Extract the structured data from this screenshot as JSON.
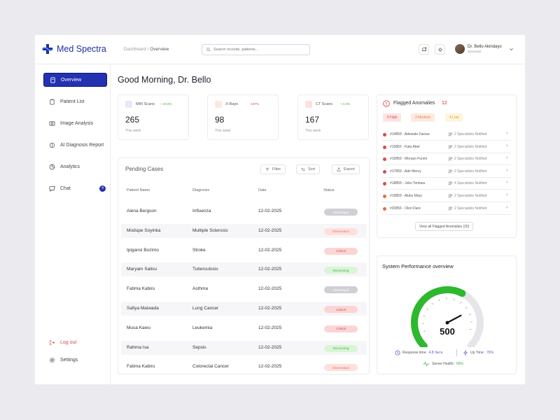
{
  "app": {
    "name": "Med Spectra"
  },
  "breadcrumb": {
    "parent": "Dashboard",
    "separator": " / ",
    "current": "Overview"
  },
  "search": {
    "placeholder": "Search records, patients..."
  },
  "user": {
    "name": "Dr. Bello Akindayo",
    "role": "Specialist"
  },
  "sidebar": {
    "items": [
      {
        "label": "Overview",
        "icon": "overview-icon",
        "active": true
      },
      {
        "label": "Patient List",
        "icon": "clipboard-icon"
      },
      {
        "label": "Image Analysis",
        "icon": "image-icon"
      },
      {
        "label": "AI Diagnosis Report",
        "icon": "brain-icon"
      },
      {
        "label": "Analytics",
        "icon": "pie-chart-icon"
      },
      {
        "label": "Chat",
        "icon": "chat-icon",
        "badge": "4"
      }
    ],
    "logout": "Log out",
    "settings": "Settings"
  },
  "greeting": "Good Morning, Dr. Bello",
  "stats": [
    {
      "name": "MRI Scans",
      "delta": "+ 20.8%",
      "value": "265",
      "sub": "This week",
      "trend": "up",
      "color": "#6b6bd0"
    },
    {
      "name": "X-Rays",
      "delta": "-107%",
      "value": "98",
      "sub": "This week",
      "trend": "down",
      "color": "#e07a5f"
    },
    {
      "name": "CT Scans",
      "delta": "+ 0.2%",
      "value": "167",
      "sub": "This week",
      "trend": "up",
      "color": "#d04040"
    }
  ],
  "cases": {
    "title": "Pending Cases",
    "filter": "Filter",
    "sort": "Sort",
    "export": "Export",
    "columns": [
      "Patient Name",
      "Diagnosis",
      "Date",
      "Status"
    ],
    "rows": [
      {
        "name": "Alena Bergson",
        "diagnosis": "Influenza",
        "date": "12-02-2025",
        "status": "Discharged"
      },
      {
        "name": "Modupe Soyinka",
        "diagnosis": "Multiple Sclerosis",
        "date": "12-02-2025",
        "status": "Observation"
      },
      {
        "name": "Ipigansi Bozimo",
        "diagnosis": "Stroke",
        "date": "12-02-2025",
        "status": "Critical"
      },
      {
        "name": "Maryam Salisu",
        "diagnosis": "Tuberculosis",
        "date": "12-02-2025",
        "status": "Recovering"
      },
      {
        "name": "Fatima Kabiru",
        "diagnosis": "Asthma",
        "date": "12-02-2025",
        "status": "Discharged"
      },
      {
        "name": "Safiya Maiwada",
        "diagnosis": "Lung Cancer",
        "date": "12-02-2025",
        "status": "Critical"
      },
      {
        "name": "Musa Kawu",
        "diagnosis": "Leukemia",
        "date": "12-02-2025",
        "status": "Critical"
      },
      {
        "name": "Rahma Isa",
        "diagnosis": "Sepsis",
        "date": "12-02-2025",
        "status": "Recovering"
      },
      {
        "name": "Fatima Kabiru",
        "diagnosis": "Colorectal Cancer",
        "date": "12-02-2025",
        "status": "Observation"
      }
    ]
  },
  "status_colors": {
    "Discharged": {
      "bg": "#cfcfd4",
      "fg": "#ffffff"
    },
    "Observation": {
      "bg": "#fde0dc",
      "fg": "#e0776a"
    },
    "Critical": {
      "bg": "#fbd5d5",
      "fg": "#d94a4a"
    },
    "Recovering": {
      "bg": "#d9f5d6",
      "fg": "#4caf50"
    }
  },
  "anomalies": {
    "title": "Flagged Anomalies",
    "count": "12",
    "severity": [
      {
        "label": "5 High",
        "bg": "#fde4e4",
        "fg": "#d94a4a"
      },
      {
        "label": "3 Medium",
        "bg": "#fdeae0",
        "fg": "#e0814a"
      },
      {
        "label": "4 Low",
        "bg": "#fdf5dc",
        "fg": "#d2a42a"
      }
    ],
    "items": [
      {
        "id": "#14859 - Adewale Favour",
        "note": "2 Specialists Notified",
        "dot": "#d94a4a"
      },
      {
        "id": "#15862 - Katu Abel",
        "note": "2 Specialists Notified",
        "dot": "#d94a4a"
      },
      {
        "id": "#16859 - Morayo Funmi",
        "note": "2 Specialists Notified",
        "dot": "#d94a4a"
      },
      {
        "id": "#17859 - Ade Mercy",
        "note": "2 Specialists Notified",
        "dot": "#d94a4a"
      },
      {
        "id": "#18859 - Joko Tomiwa",
        "note": "4 Specialists Notified",
        "dot": "#d94a4a"
      },
      {
        "id": "#19859 - Aluko Mary",
        "note": "2 Specialists Notified",
        "dot": "#e07040"
      },
      {
        "id": "#20859 - Olori Dare",
        "note": "2 Specialists Notified",
        "dot": "#e07040"
      }
    ],
    "view_all": "View all Flagged Anomalies (20)"
  },
  "performance": {
    "title": "System Performance overview",
    "value": "500",
    "value_fraction": 0.6,
    "response_label": "Response time:",
    "response_value": "4.8 Secs",
    "uptime_label": "Up Time:",
    "uptime_value": "78%",
    "health_label": "Server Health:",
    "health_value": "80%"
  }
}
